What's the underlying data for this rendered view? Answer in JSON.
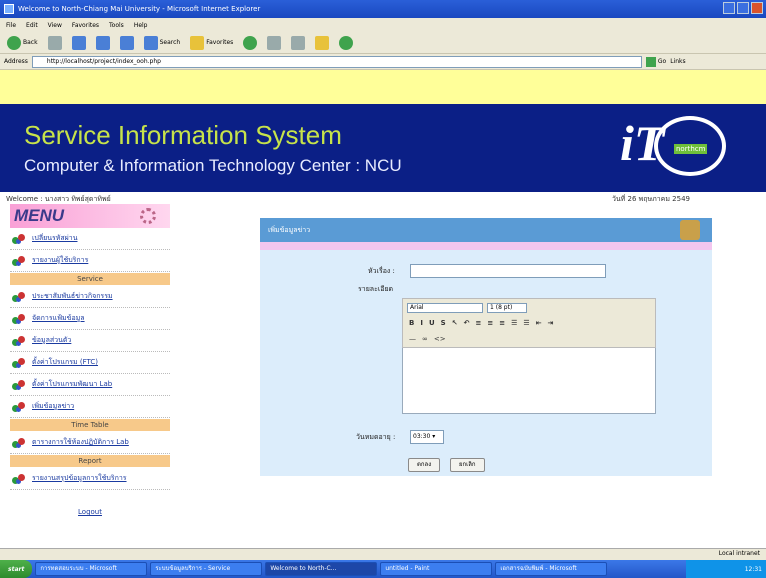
{
  "browser": {
    "window_title": "Welcome to North-Chiang Mai University - Microsoft Internet Explorer",
    "menu": [
      "File",
      "Edit",
      "View",
      "Favorites",
      "Tools",
      "Help"
    ],
    "toolbar": {
      "back": "Back",
      "search": "Search",
      "favorites": "Favorites"
    },
    "address_label": "Address",
    "address_value": "http://localhost/project/index_ooh.php",
    "go_label": "Go",
    "links_label": "Links"
  },
  "site": {
    "title": "Service Information System",
    "subtitle": "Computer & Information Technology Center : NCU",
    "logo_big": "iT",
    "logo_tag": "northcm",
    "welcome": "Welcome : นางสาว ทิพย์สุดาทิพย์",
    "date": "วันที่ 26 พฤษภาคม 2549"
  },
  "sidebar": {
    "menu_title": "MENU",
    "items_top": [
      "เปลี่ยนรหัสผ่าน",
      "รายงานผู้ใช้บริการ"
    ],
    "section_service": "Service",
    "items_service": [
      "ประชาสัมพันธ์ข่าวกิจกรรม",
      "จัดการแฟ้มข้อมูล",
      "ข้อมูลส่วนตัว",
      "ตั้งค่าโปรแกรม (FTC)",
      "ตั้งค่าโปรแกรมพัฒนา Lab",
      "เพิ่มข้อมูลข่าว"
    ],
    "section_timetable": "Time Table",
    "items_timetable": [
      "ตารางการใช้ห้องปฏิบัติการ Lab"
    ],
    "section_report": "Report",
    "items_report": [
      "รายงานสรุปข้อมูลการใช้บริการ"
    ],
    "logout": "Logout"
  },
  "panel": {
    "heading": "เพิ่มข้อมูลข่าว",
    "title_label": "หัวเรื่อง :",
    "title_value": "",
    "detail_label": "รายละเอียด",
    "font_select": "Arial",
    "size_select": "1 (8 pt)",
    "format_buttons": [
      "B",
      "I",
      "U",
      "S",
      "↖",
      "↶",
      "≡",
      "≡",
      "≡",
      "☰",
      "☰",
      "⇤",
      "⇥"
    ],
    "format_buttons2": [
      "—",
      "∞",
      "<>"
    ],
    "date_label": "วันหมดอายุ :",
    "date_value": "03:30",
    "submit": "ตกลง",
    "reset": "ยกเลิก"
  },
  "status": {
    "zone": "Local intranet"
  },
  "taskbar": {
    "start": "start",
    "tasks": [
      "การทดสอบระบบ - Microsoft",
      "ระบบข้อมูลบริการ - Service",
      "Welcome to North-C...",
      "untitled - Paint",
      "เอกสารฉบับพิมพ์ - Microsoft"
    ],
    "clock": "12:31"
  }
}
